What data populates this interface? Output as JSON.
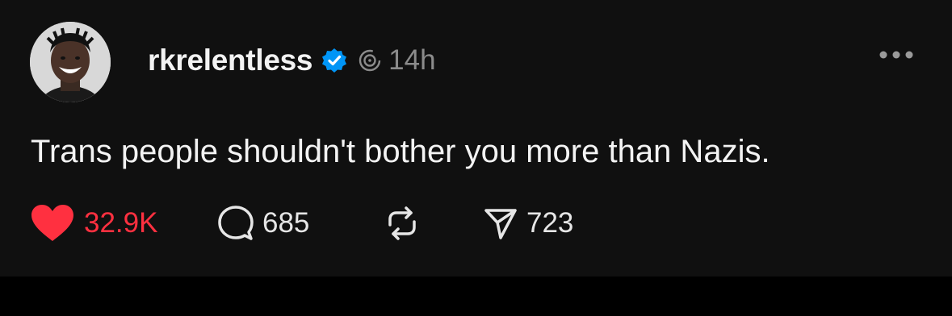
{
  "post": {
    "username": "rkrelentless",
    "time": "14h",
    "text": "Trans people shouldn't bother you more than Nazis.",
    "stats": {
      "likes": "32.9K",
      "replies": "685",
      "shares": "723"
    },
    "liked": true
  },
  "icons": {
    "verified": "verified-badge-icon",
    "thread": "threads-spiral-icon",
    "more": "more-options-icon",
    "like": "heart-icon",
    "reply": "comment-bubble-icon",
    "repost": "repost-icon",
    "share": "send-icon"
  },
  "colors": {
    "background": "#101010",
    "text": "#f3f3f3",
    "muted": "#8b8b8b",
    "verified": "#0095f6",
    "like": "#ff3040"
  }
}
